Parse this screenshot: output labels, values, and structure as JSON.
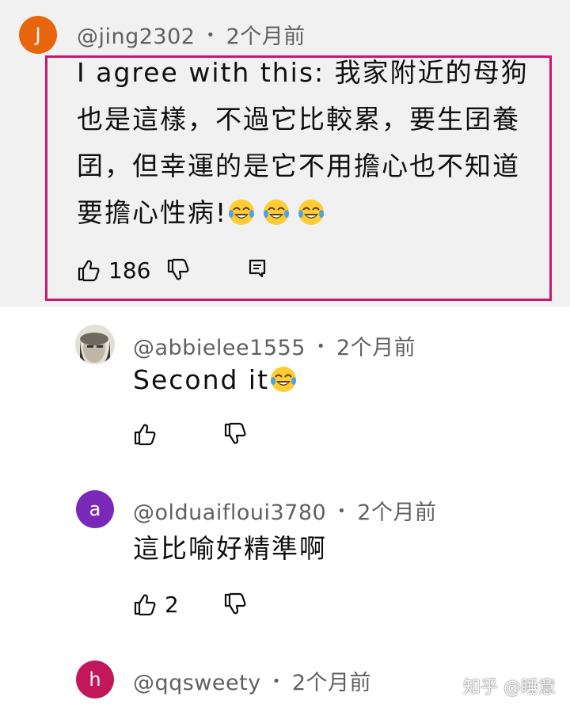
{
  "comments": [
    {
      "author": "@jing2302",
      "avatar_letter": "J",
      "avatar_color": "#e8650e",
      "time": "2个月前",
      "text": "I agree with this: 我家附近的母狗也是這樣，不過它比較累，要生囝養囝，但幸運的是它不用擔心也不知道要擔心性病!",
      "lines": [
        "I agree with this: 我家附近的母狗",
        "也是這樣，不過它比較累，要生囝養",
        "囝，但幸運的是它不用擔心也不知道",
        "要擔心性病!"
      ],
      "likes": "186",
      "highlighted": true
    },
    {
      "author": "@abbielee1555",
      "time": "2个月前",
      "text": "Second it",
      "likes": ""
    },
    {
      "author": "@olduaifloui3780",
      "avatar_letter": "a",
      "avatar_color": "#7a28b8",
      "time": "2个月前",
      "text": "這比喻好精準啊",
      "likes": "2"
    },
    {
      "author": "@qqsweety",
      "avatar_letter": "h",
      "avatar_color": "#c2185b",
      "time": "2个月前"
    }
  ],
  "separator": "•",
  "emoji_name": "face-with-tears-of-joy",
  "highlight_color": "#c8186e",
  "watermark": "知乎 @睡意"
}
